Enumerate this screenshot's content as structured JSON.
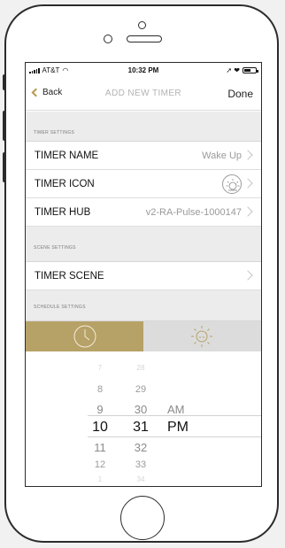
{
  "status_bar": {
    "carrier": "AT&T",
    "time": "10:32 PM",
    "right_icons": "➚ ❤"
  },
  "nav": {
    "back_label": "Back",
    "title": "ADD NEW TIMER",
    "done_label": "Done"
  },
  "sections": {
    "timer_settings": "TIMER SETTINGS",
    "scene_settings": "SCENE SETTINGS",
    "schedule_settings": "SCHEDULE SETTINGS"
  },
  "rows": {
    "timer_name": {
      "label": "TIMER NAME",
      "value": "Wake Up"
    },
    "timer_icon": {
      "label": "TIMER ICON",
      "icon": "sunrise-icon"
    },
    "timer_hub": {
      "label": "TIMER HUB",
      "value": "v2-RA-Pulse-1000147"
    },
    "timer_scene": {
      "label": "TIMER SCENE"
    }
  },
  "schedule_toggle": {
    "options": [
      "clock-icon",
      "sun-icon"
    ],
    "selected": "clock-icon"
  },
  "picker": {
    "hours": [
      "7",
      "8",
      "9",
      "10",
      "11",
      "12",
      "1"
    ],
    "minutes": [
      "28",
      "29",
      "30",
      "31",
      "32",
      "33",
      "34"
    ],
    "ampm": [
      "AM",
      "PM"
    ],
    "selected": {
      "hour": "10",
      "minute": "31",
      "ampm": "PM"
    }
  },
  "colors": {
    "accent_gold": "#b6a167",
    "segment_inactive": "#dcdcdc",
    "section_bg": "#ececec"
  }
}
